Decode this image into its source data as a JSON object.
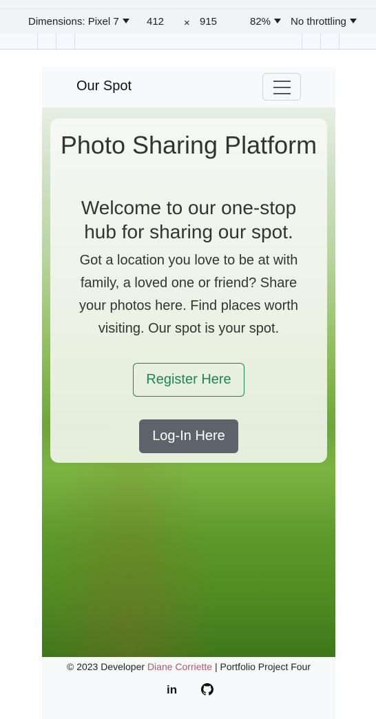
{
  "devtools": {
    "device_label": "Dimensions: Pixel 7",
    "width": "412",
    "times": "×",
    "height": "915",
    "zoom": "82%",
    "throttling": "No throttling"
  },
  "navbar": {
    "brand": "Our Spot",
    "toggler_icon": "hamburger-icon"
  },
  "hero": {
    "title": "Photo Sharing Platform",
    "subtitle": "Welcome to our one-stop hub for sharing our spot.",
    "description": "Got a location you love to be at with family, a loved one or friend? Share your photos here. Find places worth visiting. Our spot is your spot.",
    "register_label": "Register Here",
    "login_label": "Log-In Here",
    "register_color": "#198754",
    "login_bg": "#5c636a"
  },
  "footer": {
    "prefix": "© 2023 Developer",
    "author": "Diane Corriette",
    "suffix": "| Portfolio Project Four",
    "author_color": "#a95c6f",
    "linkedin_icon": "linkedin-icon",
    "github_icon": "github-icon"
  }
}
